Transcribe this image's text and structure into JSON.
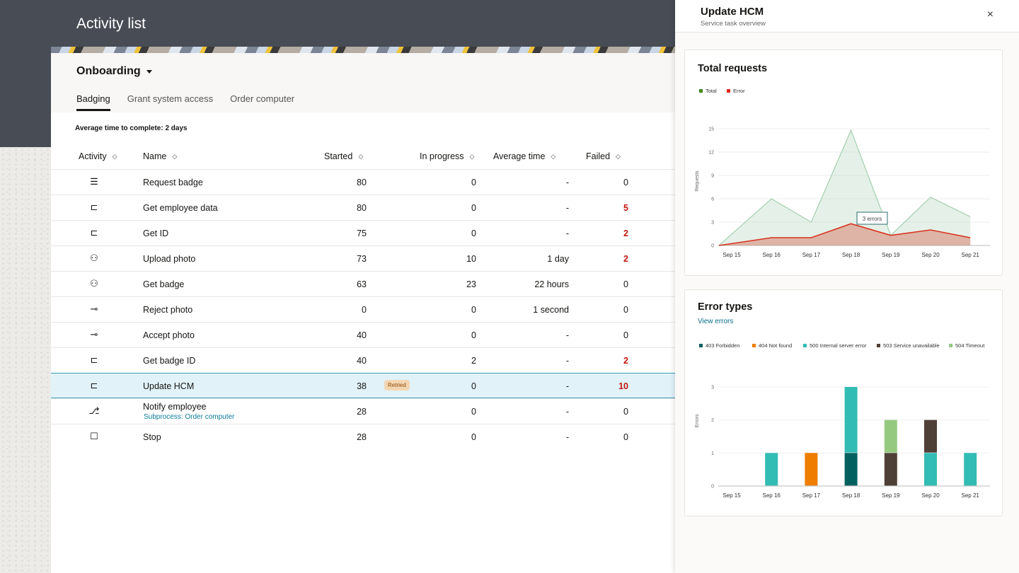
{
  "header": {
    "title": "Activity list"
  },
  "process": {
    "name": "Onboarding"
  },
  "tabs": [
    {
      "label": "Badging",
      "active": true
    },
    {
      "label": "Grant system access"
    },
    {
      "label": "Order computer"
    }
  ],
  "summary": "Average time to complete: 2 days",
  "columns": [
    "Activity",
    "Name",
    "Started",
    "In progress",
    "Average  time",
    "Failed"
  ],
  "rows": [
    {
      "icon": "list-icon",
      "name": "Request badge",
      "started": "80",
      "in_progress": "0",
      "avg": "-",
      "failed": "0"
    },
    {
      "icon": "plug-icon",
      "name": "Get employee data",
      "started": "80",
      "in_progress": "0",
      "avg": "-",
      "failed": "5"
    },
    {
      "icon": "plug-icon",
      "name": "Get ID",
      "started": "75",
      "in_progress": "0",
      "avg": "-",
      "failed": "2"
    },
    {
      "icon": "user-icon",
      "name": "Upload photo",
      "started": "73",
      "in_progress": "10",
      "avg": "1 day",
      "failed": "2"
    },
    {
      "icon": "user-check-icon",
      "name": "Get badge",
      "started": "63",
      "in_progress": "23",
      "avg": "22 hours",
      "failed": "0"
    },
    {
      "icon": "branch-icon",
      "name": "Reject photo",
      "started": "0",
      "in_progress": "0",
      "avg": "1 second",
      "failed": "0"
    },
    {
      "icon": "branch-icon",
      "name": "Accept photo",
      "started": "40",
      "in_progress": "0",
      "avg": "-",
      "failed": "0"
    },
    {
      "icon": "plug-icon",
      "name": "Get badge ID",
      "started": "40",
      "in_progress": "2",
      "avg": "-",
      "failed": "2"
    },
    {
      "icon": "plug-icon",
      "name": "Update HCM",
      "started": "38",
      "badge": "Retried",
      "in_progress": "0",
      "avg": "-",
      "failed": "10",
      "selected": true
    },
    {
      "icon": "subprocess-icon",
      "name": "Notify employee",
      "sub": "Subprocess: Order computer",
      "started": "28",
      "in_progress": "0",
      "avg": "-",
      "failed": "0"
    },
    {
      "icon": "stop-icon",
      "name": "Stop",
      "started": "28",
      "in_progress": "0",
      "avg": "-",
      "failed": "0"
    }
  ],
  "panel": {
    "title": "Update HCM",
    "subtitle": "Service task overview",
    "close": "×"
  },
  "chart_data": [
    {
      "type": "area",
      "title": "Total requests",
      "ylabel": "Requests",
      "ylim": [
        0,
        15
      ],
      "yticks": [
        0,
        3,
        6,
        9,
        12,
        15
      ],
      "grid": true,
      "legend": "top-left",
      "x": [
        "Sep 15",
        "Sep 16",
        "Sep 17",
        "Sep 18",
        "Sep 19",
        "Sep 20",
        "Sep 21"
      ],
      "series": [
        {
          "name": "Total",
          "color": "#3f8a1a",
          "values": [
            0,
            6,
            3,
            14.8,
            1.3,
            6.2,
            3.7
          ]
        },
        {
          "name": "Error",
          "color": "#e0251b",
          "values": [
            0,
            1,
            1,
            2.8,
            1.3,
            2,
            1
          ]
        }
      ],
      "tooltip": "3 errors"
    },
    {
      "type": "bar",
      "stacked": true,
      "title": "Error types",
      "link": "View errors",
      "ylabel": "Errors",
      "ylim": [
        0,
        3
      ],
      "yticks": [
        0,
        1,
        2,
        3
      ],
      "grid": true,
      "legend": "top-left",
      "x": [
        "Sep 15",
        "Sep 16",
        "Sep 17",
        "Sep 18",
        "Sep 19",
        "Sep 20",
        "Sep 21"
      ],
      "series": [
        {
          "name": "403 Forbidden",
          "color": "#02605f",
          "values": [
            0,
            0,
            0,
            1,
            0,
            0,
            0
          ]
        },
        {
          "name": "404 Not found",
          "color": "#ee7d00",
          "values": [
            0,
            0,
            1,
            0,
            0,
            0,
            0
          ]
        },
        {
          "name": "500 Internal server error",
          "color": "#31bcb4",
          "values": [
            0,
            1,
            0,
            2,
            0,
            1,
            1
          ]
        },
        {
          "name": "503 Service unavailable",
          "color": "#4f4037",
          "values": [
            0,
            0,
            0,
            0,
            1,
            1,
            0
          ]
        },
        {
          "name": "504 Timeout",
          "color": "#95c980",
          "values": [
            0,
            0,
            0,
            0,
            1,
            0,
            0
          ]
        }
      ]
    }
  ]
}
